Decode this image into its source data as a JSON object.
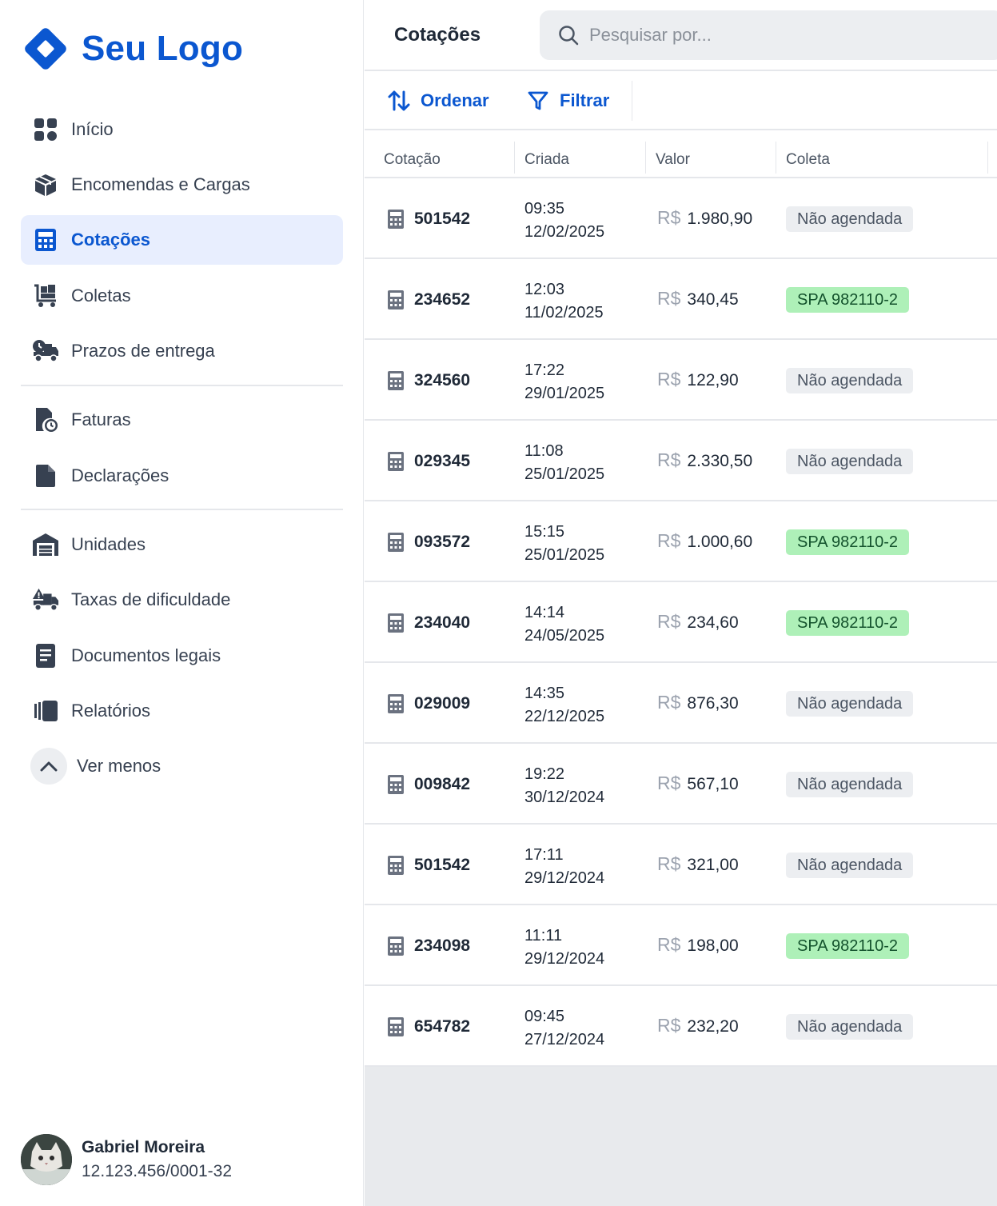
{
  "brand": {
    "name": "Seu Logo",
    "color": "#0b57d0"
  },
  "sidebar": {
    "items": [
      {
        "label": "Início",
        "icon": "grid-icon"
      },
      {
        "label": "Encomendas e Cargas",
        "icon": "box-icon"
      },
      {
        "label": "Cotações",
        "icon": "calculator-icon",
        "active": true
      },
      {
        "label": "Coletas",
        "icon": "cart-icon"
      },
      {
        "label": "Prazos de entrega",
        "icon": "truck-clock-icon"
      },
      {
        "label": "Faturas",
        "icon": "invoice-clock-icon"
      },
      {
        "label": "Declarações",
        "icon": "document-icon"
      },
      {
        "label": "Unidades",
        "icon": "warehouse-icon"
      },
      {
        "label": "Taxas de dificuldade",
        "icon": "truck-warning-icon"
      },
      {
        "label": "Documentos legais",
        "icon": "legal-document-icon"
      },
      {
        "label": "Relatórios",
        "icon": "reports-icon"
      }
    ],
    "toggle_label": "Ver menos"
  },
  "user": {
    "name": "Gabriel Moreira",
    "document": "12.123.456/0001-32"
  },
  "header": {
    "title": "Cotações",
    "search_placeholder": "Pesquisar por..."
  },
  "toolbar": {
    "sort_label": "Ordenar",
    "filter_label": "Filtrar"
  },
  "table": {
    "columns": [
      "Cotação",
      "Criada",
      "Valor",
      "Coleta"
    ],
    "currency": "R$",
    "rows": [
      {
        "id": "501542",
        "time": "09:35",
        "date": "12/02/2025",
        "valor": "1.980,90",
        "coleta": "Não agendada",
        "status": "grey"
      },
      {
        "id": "234652",
        "time": "12:03",
        "date": "11/02/2025",
        "valor": "340,45",
        "coleta": "SPA 982110-2",
        "status": "green"
      },
      {
        "id": "324560",
        "time": "17:22",
        "date": "29/01/2025",
        "valor": "122,90",
        "coleta": "Não agendada",
        "status": "grey"
      },
      {
        "id": "029345",
        "time": "11:08",
        "date": "25/01/2025",
        "valor": "2.330,50",
        "coleta": "Não agendada",
        "status": "grey"
      },
      {
        "id": "093572",
        "time": "15:15",
        "date": "25/01/2025",
        "valor": "1.000,60",
        "coleta": "SPA 982110-2",
        "status": "green"
      },
      {
        "id": "234040",
        "time": "14:14",
        "date": "24/05/2025",
        "valor": "234,60",
        "coleta": "SPA 982110-2",
        "status": "green"
      },
      {
        "id": "029009",
        "time": "14:35",
        "date": "22/12/2025",
        "valor": "876,30",
        "coleta": "Não agendada",
        "status": "grey"
      },
      {
        "id": "009842",
        "time": "19:22",
        "date": "30/12/2024",
        "valor": "567,10",
        "coleta": "Não agendada",
        "status": "grey"
      },
      {
        "id": "501542",
        "time": "17:11",
        "date": "29/12/2024",
        "valor": "321,00",
        "coleta": "Não agendada",
        "status": "grey"
      },
      {
        "id": "234098",
        "time": "11:11",
        "date": "29/12/2024",
        "valor": "198,00",
        "coleta": "SPA 982110-2",
        "status": "green"
      },
      {
        "id": "654782",
        "time": "09:45",
        "date": "27/12/2024",
        "valor": "232,20",
        "coleta": "Não agendada",
        "status": "grey"
      }
    ]
  }
}
